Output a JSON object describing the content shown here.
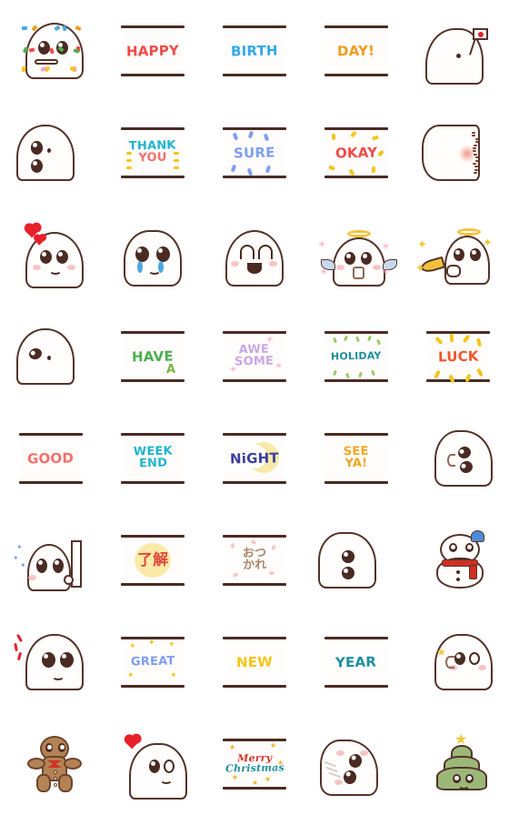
{
  "meta": {
    "title": "Ghost Emoji Sticker Set",
    "columns": 5,
    "rows": 8,
    "background": "#ffffff"
  },
  "palette": {
    "outline": "#53332a",
    "card_bg": "#fffdfb",
    "card_bar": "#4a2b23",
    "red": "#f04a4a",
    "coral": "#f2706b",
    "blue": "#33a8e8",
    "orange": "#f59a1e",
    "cyan": "#1fb5cf",
    "periwinkle": "#7f9ef0",
    "yellow": "#f5c518",
    "green": "#4caf50",
    "lavender": "#c9a6e6",
    "teal": "#1d8fa0",
    "navy": "#3b3f9e",
    "gold": "#f0b429",
    "brown": "#a9856b",
    "scarf_red": "#cf3022"
  },
  "stickers": [
    {
      "row": 1,
      "col": 1,
      "kind": "character",
      "name": "ghost-party-blower",
      "label": "Ghost with party blower and confetti"
    },
    {
      "row": 1,
      "col": 2,
      "kind": "card",
      "name": "card-happy",
      "text": "HAPPY",
      "color": "#f04a4a",
      "size": "t1",
      "deco": "none"
    },
    {
      "row": 1,
      "col": 3,
      "kind": "card",
      "name": "card-birth",
      "text": "BIRTH",
      "color": "#33a8e8",
      "size": "t1",
      "deco": "none"
    },
    {
      "row": 1,
      "col": 4,
      "kind": "card",
      "name": "card-day",
      "text": "DAY!",
      "color": "#f59a1e",
      "size": "t1",
      "deco": "none"
    },
    {
      "row": 1,
      "col": 5,
      "kind": "character",
      "name": "ghost-with-flag",
      "label": "Ghost holding Japanese flag"
    },
    {
      "row": 2,
      "col": 1,
      "kind": "character",
      "name": "ghost-sideways-peek",
      "label": "Ghost peeking sideways"
    },
    {
      "row": 2,
      "col": 2,
      "kind": "card",
      "name": "card-thank-you",
      "text": "THANK\nYOU",
      "color": "#1fb5cf",
      "color2": "#f2706b",
      "size": "t2",
      "deco": "dashes-yellow"
    },
    {
      "row": 2,
      "col": 3,
      "kind": "card",
      "name": "card-sure",
      "text": "SURE",
      "color": "#7f9ef0",
      "size": "t1",
      "deco": "dots-blue"
    },
    {
      "row": 2,
      "col": 4,
      "kind": "card",
      "name": "card-okay",
      "text": "OKAY",
      "color": "#f04a4a",
      "size": "t1",
      "deco": "dots-yellow"
    },
    {
      "row": 2,
      "col": 5,
      "kind": "character",
      "name": "ghost-blushing-back",
      "label": "Ghost turned away blushing"
    },
    {
      "row": 3,
      "col": 1,
      "kind": "character",
      "name": "ghost-in-love",
      "label": "Ghost with hearts"
    },
    {
      "row": 3,
      "col": 2,
      "kind": "character",
      "name": "ghost-crying",
      "label": "Ghost crying with sparkling eyes"
    },
    {
      "row": 3,
      "col": 3,
      "kind": "character",
      "name": "ghost-happy-open-mouth",
      "label": "Ghost smiling with open mouth"
    },
    {
      "row": 3,
      "col": 4,
      "kind": "character",
      "name": "ghost-angel",
      "label": "Angel ghost with halo and wings"
    },
    {
      "row": 3,
      "col": 5,
      "kind": "character",
      "name": "ghost-angel-trumpet",
      "label": "Angel ghost blowing golden trumpet"
    },
    {
      "row": 4,
      "col": 1,
      "kind": "character",
      "name": "ghost-side-calm",
      "label": "Ghost facing sideways calmly"
    },
    {
      "row": 4,
      "col": 2,
      "kind": "card",
      "name": "card-have-a",
      "text": "HAVE",
      "color": "#4caf50",
      "size": "t1",
      "deco": "have-a"
    },
    {
      "row": 4,
      "col": 3,
      "kind": "card",
      "name": "card-awesome",
      "text": "AWE\nSOME",
      "color": "#c9a6e6",
      "size": "t2",
      "deco": "sparkle-pink"
    },
    {
      "row": 4,
      "col": 4,
      "kind": "card",
      "name": "card-holiday",
      "text": "HOLIDAY",
      "color": "#1d8fa0",
      "size": "t3",
      "deco": "dashes-green"
    },
    {
      "row": 4,
      "col": 5,
      "kind": "card",
      "name": "card-luck",
      "text": "LUCK",
      "color": "#f2542d",
      "size": "t1",
      "deco": "rays-yellow"
    },
    {
      "row": 5,
      "col": 1,
      "kind": "card",
      "name": "card-good",
      "text": "GOOD",
      "color": "#f2706b",
      "size": "t1",
      "deco": "none"
    },
    {
      "row": 5,
      "col": 2,
      "kind": "card",
      "name": "card-weekend",
      "text": "WEEK\nEND",
      "color": "#1fb5cf",
      "size": "t2",
      "deco": "none"
    },
    {
      "row": 5,
      "col": 3,
      "kind": "card",
      "name": "card-night",
      "text": "NiGHT",
      "color": "#3b3f9e",
      "size": "t1",
      "deco": "moon"
    },
    {
      "row": 5,
      "col": 4,
      "kind": "card",
      "name": "card-see-ya",
      "text": "SEE\nYA!",
      "color": "#f5a51e",
      "size": "t2",
      "deco": "none"
    },
    {
      "row": 5,
      "col": 5,
      "kind": "character",
      "name": "ghost-sleepy-side",
      "label": "Ghost resting on its side"
    },
    {
      "row": 6,
      "col": 1,
      "kind": "character",
      "name": "ghost-with-banner",
      "label": "Ghost holding a blank banner"
    },
    {
      "row": 6,
      "col": 2,
      "kind": "card",
      "name": "card-ryoukai",
      "text": "了解",
      "color": "#e0483c",
      "size": "tjp",
      "deco": "sun-yellow"
    },
    {
      "row": 6,
      "col": 3,
      "kind": "card",
      "name": "card-otsukare",
      "text": "おつ\nかれ",
      "color": "#a9856b",
      "size": "tjp-s",
      "deco": "petals-pink"
    },
    {
      "row": 6,
      "col": 4,
      "kind": "character",
      "name": "ghost-peek-corner",
      "label": "Ghost peeking from corner"
    },
    {
      "row": 6,
      "col": 5,
      "kind": "character",
      "name": "ghost-snowman",
      "label": "Snowman ghost with red scarf and blue hat"
    },
    {
      "row": 7,
      "col": 1,
      "kind": "character",
      "name": "ghost-surprised",
      "label": "Surprised ghost with motion marks"
    },
    {
      "row": 7,
      "col": 2,
      "kind": "card",
      "name": "card-great",
      "text": "GREAT",
      "color": "#7f9ef0",
      "size": "t2",
      "deco": "sparkle-yellow"
    },
    {
      "row": 7,
      "col": 3,
      "kind": "card",
      "name": "card-new",
      "text": "NEW",
      "color": "#f5c518",
      "size": "t1",
      "deco": "none"
    },
    {
      "row": 7,
      "col": 4,
      "kind": "card",
      "name": "card-year",
      "text": "YEAR",
      "color": "#1d8fa0",
      "size": "t1",
      "deco": "none"
    },
    {
      "row": 7,
      "col": 5,
      "kind": "character",
      "name": "ghost-wink-star",
      "label": "Winking ghost with star"
    },
    {
      "row": 8,
      "col": 1,
      "kind": "character",
      "name": "gingerbread-man",
      "label": "Gingerbread man with bow tie"
    },
    {
      "row": 8,
      "col": 2,
      "kind": "character",
      "name": "ghost-heart-smile",
      "label": "Smiling ghost with red heart"
    },
    {
      "row": 8,
      "col": 3,
      "kind": "card",
      "name": "card-merry-christmas",
      "text": "Merry\nChristmas",
      "color": "#d6332b",
      "color2": "#1d8fa0",
      "size": "t3",
      "deco": "stars-gold"
    },
    {
      "row": 8,
      "col": 4,
      "kind": "character",
      "name": "ghost-lying-down",
      "label": "Ghost lying down sideways"
    },
    {
      "row": 8,
      "col": 5,
      "kind": "character",
      "name": "ghost-christmas-tree",
      "label": "Christmas tree ghost with gold star"
    }
  ]
}
